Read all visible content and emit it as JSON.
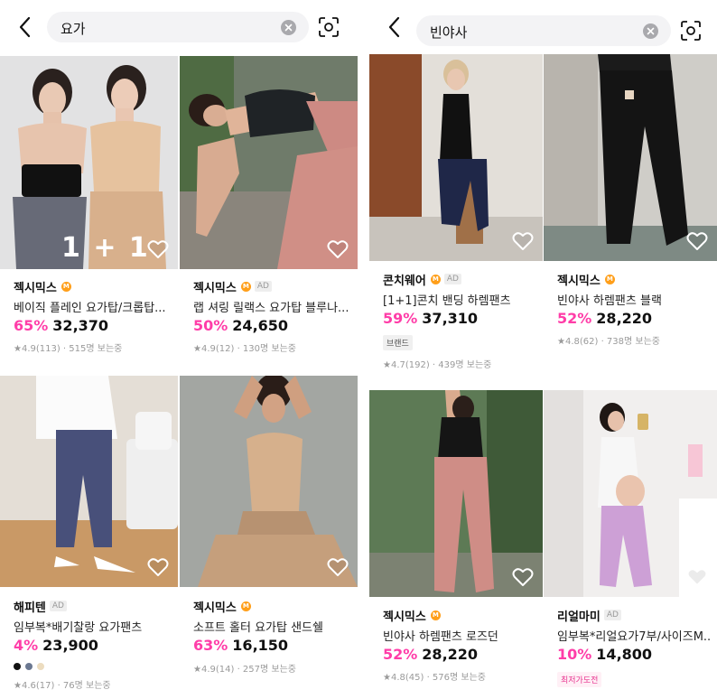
{
  "colors": {
    "accent_pink": "#ff3da8",
    "m_badge": "#ff9f1a",
    "text_gray": "#9a9a9a"
  },
  "left": {
    "search": {
      "query": "요가",
      "back_icon": "chevron-left-icon",
      "clear_icon": "clear-x-icon",
      "camera_icon": "camera-scan-icon"
    },
    "products": [
      {
        "brand": "젝시믹스",
        "m_badge": "M",
        "ad": "",
        "title": "베이직 플레인 요가탑/크롭탑...",
        "discount": "65%",
        "price": "32,370",
        "rating": "★4.9(113) · 515명 보는중",
        "promo": "1 + 1"
      },
      {
        "brand": "젝시믹스",
        "m_badge": "M",
        "ad": "AD",
        "title": "랩 셔링 릴랙스 요가탑 블루나...",
        "discount": "50%",
        "price": "24,650",
        "rating": "★4.9(12) · 130명 보는중"
      },
      {
        "brand": "해피텐",
        "m_badge": "",
        "ad": "AD",
        "title": "임부복*배기찰랑 요가팬츠",
        "discount": "4%",
        "price": "23,900",
        "rating": "★4.6(17) · 76명 보는중",
        "swatches": [
          "#111111",
          "#6b7891",
          "#ecdcbf"
        ]
      },
      {
        "brand": "젝시믹스",
        "m_badge": "M",
        "ad": "",
        "title": "소프트 홀터 요가탑 샌드쉘",
        "discount": "63%",
        "price": "16,150",
        "rating": "★4.9(14) · 257명 보는중"
      }
    ]
  },
  "right": {
    "search": {
      "query": "빈야사",
      "back_icon": "chevron-left-icon",
      "clear_icon": "clear-x-icon",
      "camera_icon": "camera-scan-icon"
    },
    "products": [
      {
        "brand": "콘치웨어",
        "m_badge": "M",
        "ad": "AD",
        "title": "[1+1]콘치 밴딩 하렘팬츠",
        "discount": "59%",
        "price": "37,310",
        "chip": "브랜드",
        "rating": "★4.7(192) · 439명 보는중"
      },
      {
        "brand": "젝시믹스",
        "m_badge": "M",
        "ad": "",
        "title": "빈야사 하렘팬츠 블랙",
        "discount": "52%",
        "price": "28,220",
        "rating": "★4.8(62) · 738명 보는중"
      },
      {
        "brand": "젝시믹스",
        "m_badge": "M",
        "ad": "",
        "title": "빈야사 하렘팬츠 로즈던",
        "discount": "52%",
        "price": "28,220",
        "rating": "★4.8(45) · 576명 보는중"
      },
      {
        "brand": "리얼마미",
        "m_badge": "",
        "ad": "AD",
        "title": "임부복*리얼요가7부/사이즈M...",
        "discount": "10%",
        "price": "14,800",
        "chip": "최저가도전"
      }
    ]
  }
}
